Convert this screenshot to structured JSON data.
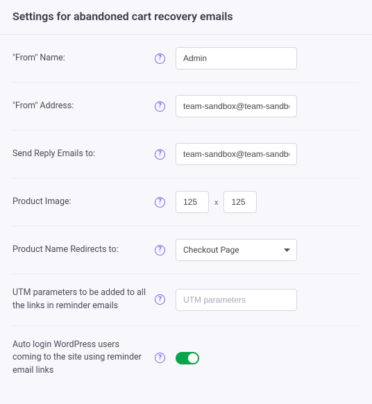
{
  "header": {
    "title": "Settings for abandoned cart recovery emails"
  },
  "rows": {
    "from_name": {
      "label": "\"From\" Name:",
      "value": "Admin"
    },
    "from_addr": {
      "label": "\"From\" Address:",
      "value": "team-sandbox@team-sandbox.tychesof"
    },
    "reply_to": {
      "label": "Send Reply Emails to:",
      "value": "team-sandbox@team-sandbox.tychesof"
    },
    "prod_image": {
      "label": "Product Image:",
      "w": "125",
      "h": "125",
      "sep": "x"
    },
    "prod_redirect": {
      "label": "Product Name Redirects to:",
      "value": "Checkout Page"
    },
    "utm": {
      "label": "UTM parameters to be added to all the links in reminder emails",
      "placeholder": "UTM parameters",
      "value": ""
    },
    "autologin": {
      "label": "Auto login WordPress users coming to the site using reminder email links",
      "on": true
    }
  },
  "help_glyph": "?"
}
